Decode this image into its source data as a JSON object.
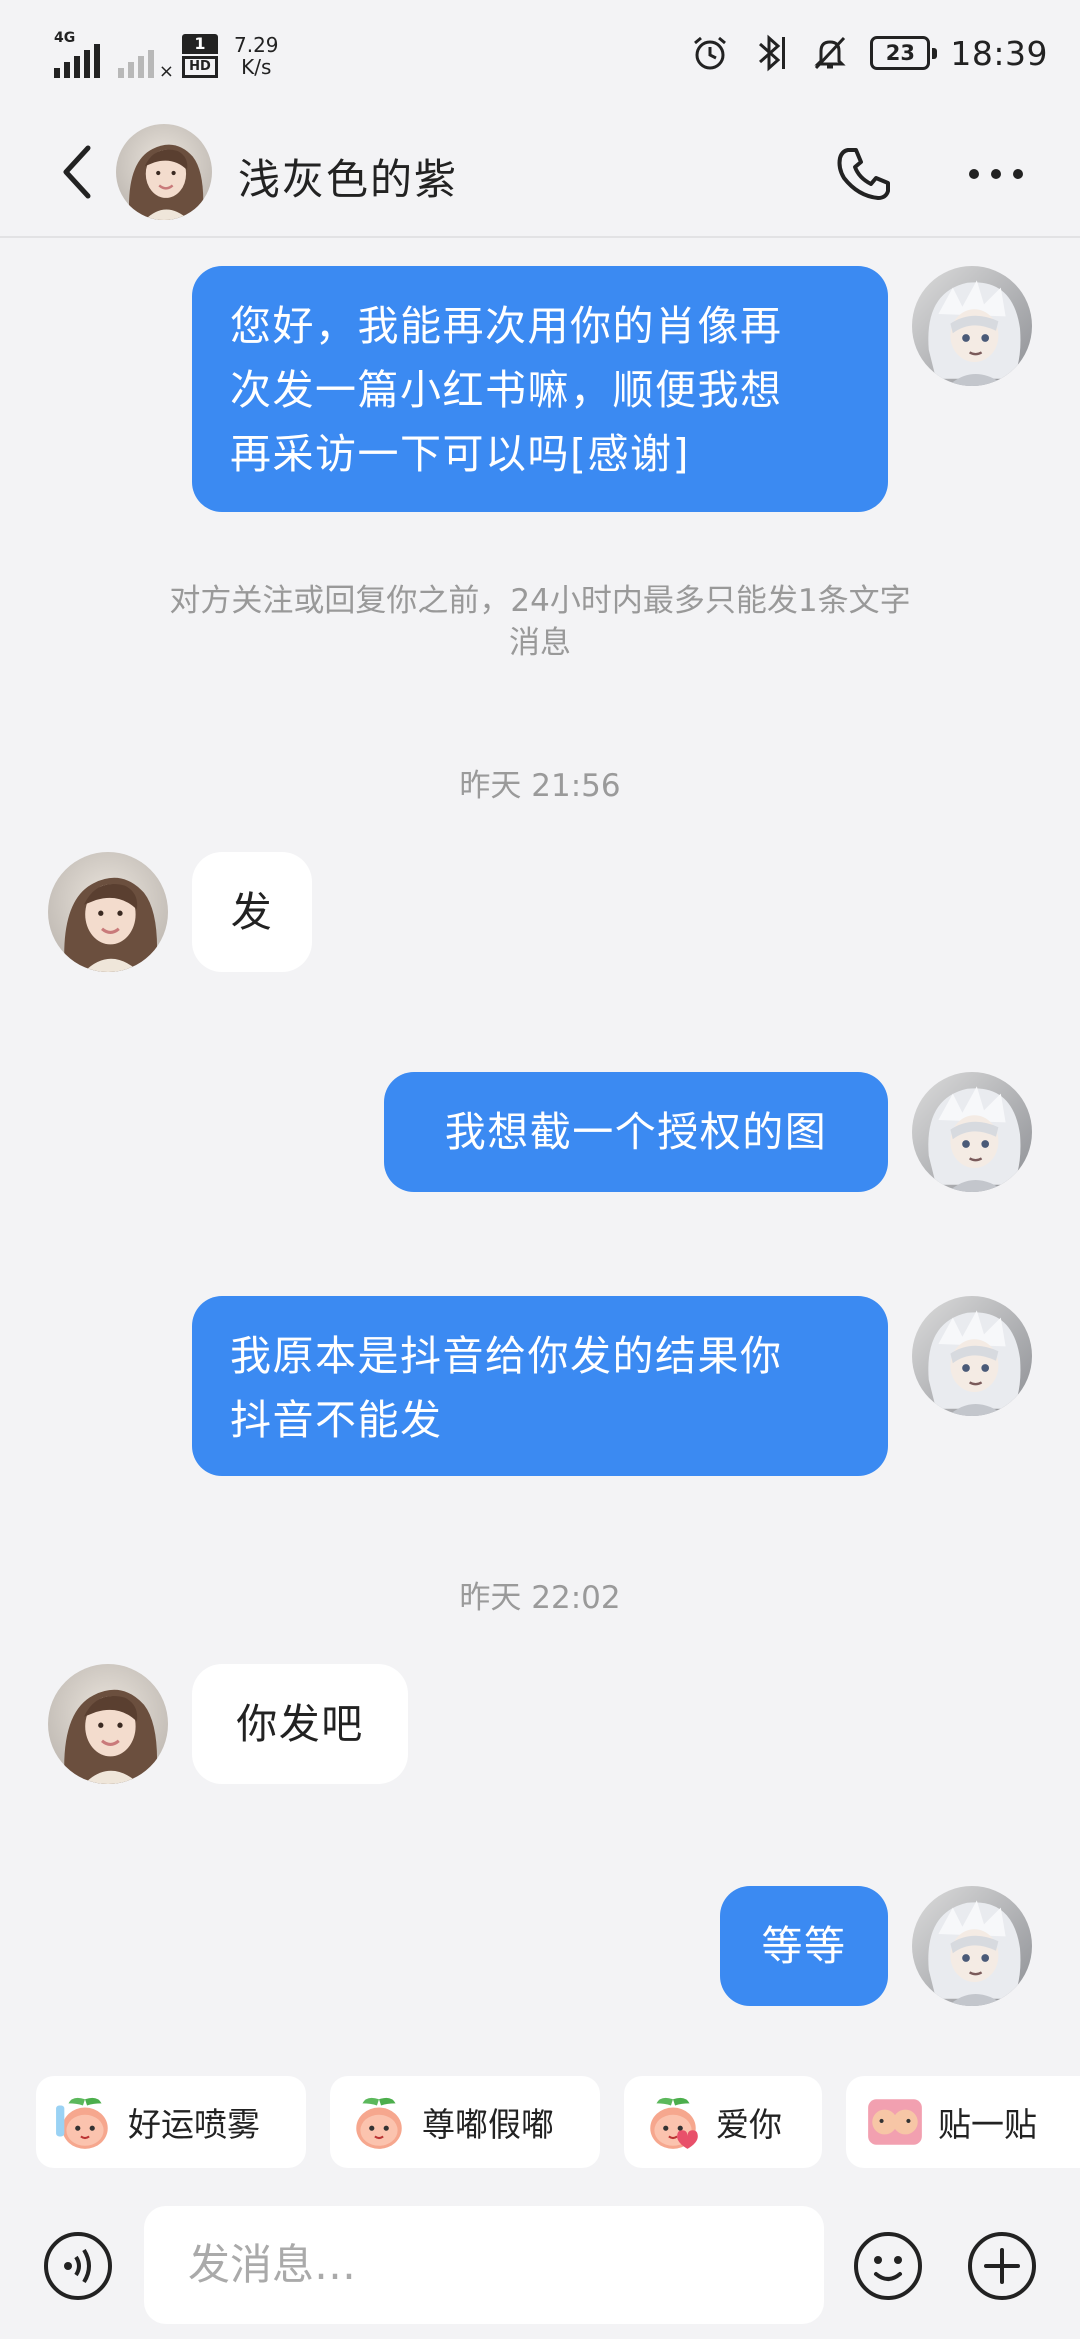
{
  "status_bar": {
    "network_tag": "4G",
    "sim_tag": "1",
    "hd_tag": "HD",
    "speed_value": "7.29",
    "speed_unit": "K/s",
    "battery": "23",
    "time": "18:39",
    "icons": [
      "signal-icon",
      "no-signal-icon",
      "alarm-icon",
      "bluetooth-icon",
      "mute-icon",
      "battery-icon"
    ]
  },
  "header": {
    "contact_name": "浅灰色的紫",
    "icons": [
      "back-arrow-icon",
      "phone-icon",
      "more-icon"
    ]
  },
  "messages": [
    {
      "id": "m1",
      "side": "out",
      "text": "您好，我能再次用你的肖像再次发一篇小红书嘛，顺便我想再采访一下可以吗[感谢]"
    },
    {
      "id": "notice",
      "type": "system",
      "text": "对方关注或回复你之前，24小时内最多只能发1条文字消息"
    },
    {
      "id": "t1",
      "type": "timestamp",
      "text": "昨天 21:56"
    },
    {
      "id": "m2",
      "side": "in",
      "text": "发"
    },
    {
      "id": "m3",
      "side": "out",
      "text": "我想截一个授权的图"
    },
    {
      "id": "m4",
      "side": "out",
      "text": "我原本是抖音给你发的结果你抖音不能发"
    },
    {
      "id": "t2",
      "type": "timestamp",
      "text": "昨天 22:02"
    },
    {
      "id": "m5",
      "side": "in",
      "text": "你发吧"
    },
    {
      "id": "m6",
      "side": "out",
      "text": "等等"
    }
  ],
  "view": {
    "m1_line1": "您好，我能再次用你的肖像再",
    "m1_line2": "次发一篇小红书嘛，顺便我想",
    "m1_line3": "再采访一下可以吗[感谢]",
    "notice_line1": "对方关注或回复你之前，24小时内最多只能发1条文字",
    "notice_line2": "消息",
    "m4_line1": "我原本是抖音给你发的结果你",
    "m4_line2": "抖音不能发"
  },
  "quick_replies": [
    {
      "label": "好运喷雾",
      "icon": "peach-spray-icon"
    },
    {
      "label": "尊嘟假嘟",
      "icon": "peach-face-icon"
    },
    {
      "label": "爱你",
      "icon": "peach-heart-icon"
    },
    {
      "label": "贴一贴",
      "icon": "hug-sticker-icon"
    }
  ],
  "input": {
    "placeholder": "发消息…",
    "icons": [
      "voice-icon",
      "emoji-icon",
      "plus-icon"
    ]
  },
  "colors": {
    "outgoing_bubble": "#3b8af2",
    "incoming_bubble": "#ffffff",
    "background": "#f3f3f5",
    "meta_text": "#999999"
  }
}
